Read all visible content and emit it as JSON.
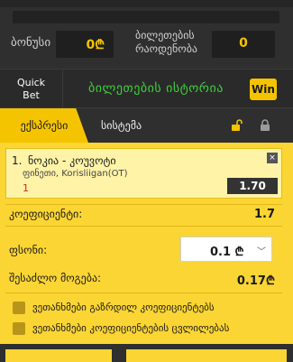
{
  "bonus": {
    "label": "ბონუსი",
    "value": "0₾"
  },
  "tickets": {
    "label": "ბილეთების რაოდენობა",
    "value": "0"
  },
  "quick_bet": {
    "line1": "Quick",
    "line2": "Bet"
  },
  "history": {
    "label": "ბილეთების ისტორია",
    "badge": "Win"
  },
  "tabs": {
    "express": "ექსპრესი",
    "system": "სისტემა"
  },
  "event": {
    "number": "1.",
    "name": "ნოკია - კოუვოტი",
    "league": "ფინეთი, Korisliigan(OT)",
    "pick": "1",
    "odd": "1.70",
    "close": "×"
  },
  "coefficient": {
    "label": "კოეფიციენტი:",
    "value": "1.7"
  },
  "stake": {
    "label": "ფსონი:",
    "value": "0.1 ₾",
    "chevron": "﹀"
  },
  "possible_win": {
    "label": "შესაძლო მოგება:",
    "value": "0.17₾"
  },
  "options": [
    {
      "label": "ვეთანხმები გაზრდილ კოეფიციენტებს"
    },
    {
      "label": "ვეთანხმები კოეფიციენტების ცვლილებას"
    }
  ],
  "icons": {
    "unlock": "unlock-icon",
    "lock": "lock-icon"
  },
  "colors": {
    "accent": "#f5c400",
    "slip_bg": "#fbd533",
    "history_green": "#3dd13d"
  }
}
